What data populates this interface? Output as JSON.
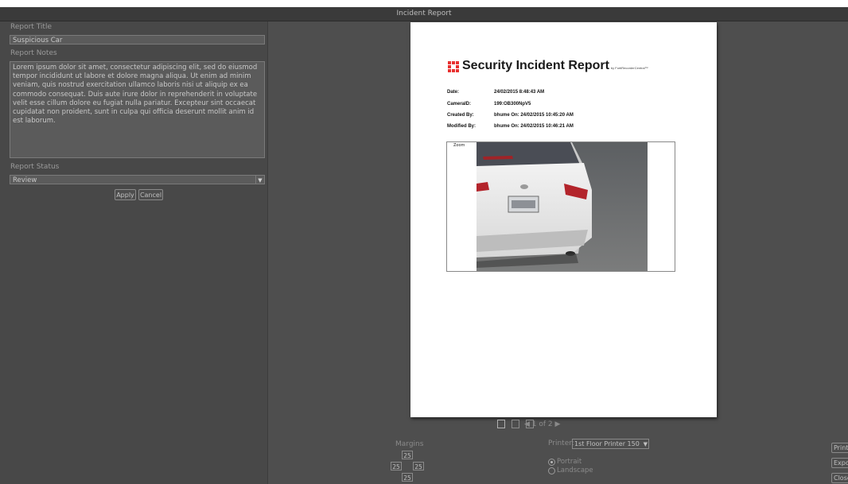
{
  "window": {
    "title": "Incident Report"
  },
  "form": {
    "title_label": "Report Title",
    "title_value": "Suspicious Car",
    "notes_label": "Report Notes",
    "notes_value": "Lorem ipsum dolor sit amet, consectetur adipiscing elit, sed do eiusmod tempor incididunt ut labore et dolore magna aliqua. Ut enim ad minim veniam, quis nostrud exercitation ullamco laboris nisi ut aliquip ex ea commodo consequat. Duis aute irure dolor in reprehenderit in voluptate velit esse cillum dolore eu fugiat nulla pariatur. Excepteur sint occaecat cupidatat non proident, sunt in culpa qui officia deserunt mollit anim id est laborum.",
    "status_label": "Report Status",
    "status_value": "Review",
    "apply_label": "Apply",
    "cancel_label": "Cancel"
  },
  "document": {
    "title": "Security Incident Report",
    "byline": "by FortiRecorderCentral™",
    "meta": [
      {
        "key": "Date:",
        "value": "24/02/2015 8:48:43 AM"
      },
      {
        "key": "CameraID:",
        "value": "199:OB300NpV5"
      },
      {
        "key": "Created By:",
        "value": "bhume   On: 24/02/2015 10:45:20 AM"
      },
      {
        "key": "Modified By:",
        "value": "bhume   On: 24/02/2015 10:46:21 AM"
      }
    ],
    "zoom_label": "Zoom"
  },
  "pager": {
    "text": "1 of 2"
  },
  "print": {
    "margins_label": "Margins",
    "margin_top": "25",
    "margin_left": "25",
    "margin_right": "25",
    "margin_bottom": "25",
    "printer_label": "Printer:",
    "printer_value": "1st Floor Printer 150",
    "orientation_portrait": "Portrait",
    "orientation_landscape": "Landscape",
    "orientation_selected": "Portrait",
    "print_button": "Print",
    "export_button": "Export",
    "close_button": "Close"
  },
  "icons": [
    "single-page-view-icon",
    "two-page-view-icon",
    "multi-page-view-icon",
    "prev-page-icon",
    "next-page-icon",
    "dropdown-arrow-icon",
    "fortinet-logo-icon"
  ],
  "colors": {
    "logo_red": "#e8302f",
    "panel_bg": "#484848",
    "preview_bg": "#4e4e4e"
  }
}
